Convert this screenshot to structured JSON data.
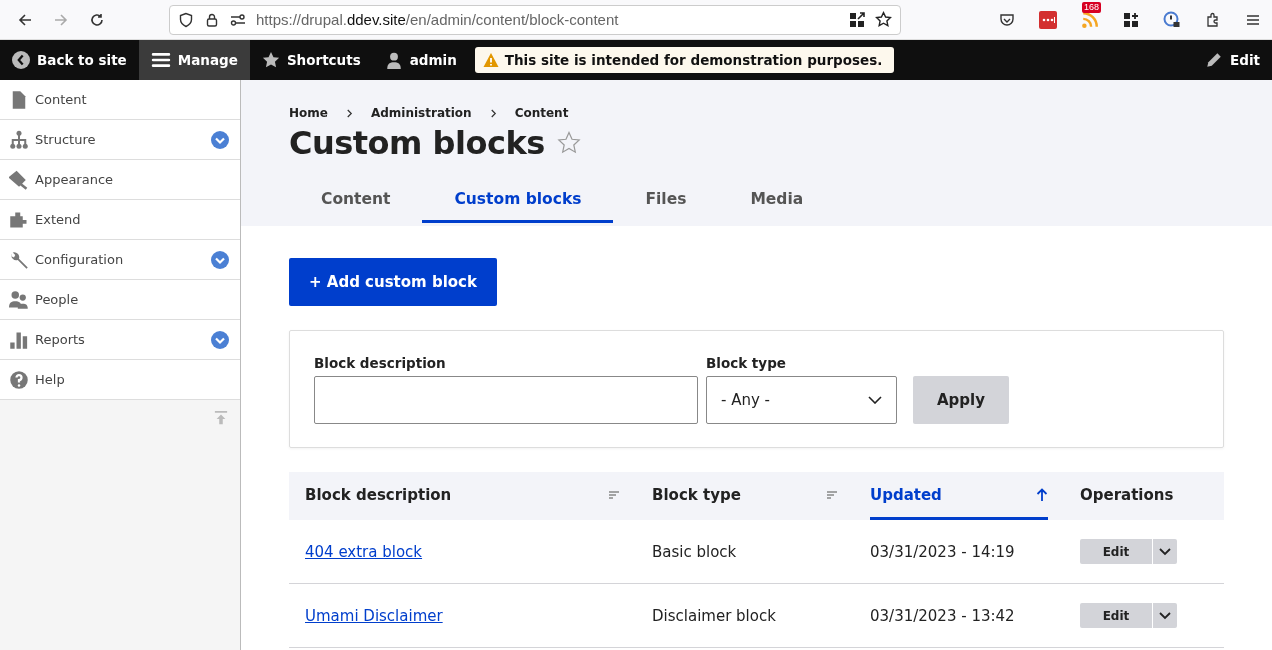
{
  "browser": {
    "url": {
      "scheme": "https://drupal.",
      "host": "ddev.site",
      "path": "/en/admin/content/block-content"
    },
    "feed_badge": "168"
  },
  "toolbar": {
    "items": [
      {
        "kind": "back",
        "label": "Back to site",
        "selected": false
      },
      {
        "kind": "manage",
        "label": "Manage",
        "selected": true
      },
      {
        "kind": "shortcuts",
        "label": "Shortcuts",
        "selected": false
      },
      {
        "kind": "user",
        "label": "admin",
        "selected": false
      }
    ],
    "notice": "This site is intended for demonstration purposes.",
    "edit": "Edit"
  },
  "sidebar": {
    "items": [
      {
        "kind": "content",
        "label": "Content",
        "expandable": false
      },
      {
        "kind": "structure",
        "label": "Structure",
        "expandable": true
      },
      {
        "kind": "appearance",
        "label": "Appearance",
        "expandable": false
      },
      {
        "kind": "extend",
        "label": "Extend",
        "expandable": false
      },
      {
        "kind": "configuration",
        "label": "Configuration",
        "expandable": true
      },
      {
        "kind": "people",
        "label": "People",
        "expandable": false
      },
      {
        "kind": "reports",
        "label": "Reports",
        "expandable": true
      },
      {
        "kind": "help",
        "label": "Help",
        "expandable": false
      }
    ]
  },
  "breadcrumb": [
    "Home",
    "Administration",
    "Content"
  ],
  "title": "Custom blocks",
  "tabs": [
    {
      "label": "Content",
      "selected": false
    },
    {
      "label": "Custom blocks",
      "selected": true
    },
    {
      "label": "Files",
      "selected": false
    },
    {
      "label": "Media",
      "selected": false
    }
  ],
  "add_button": "+ Add custom block",
  "filter": {
    "description_label": "Block description",
    "type_label": "Block type",
    "type_value": "- Any -",
    "apply": "Apply"
  },
  "table": {
    "columns": [
      {
        "label": "Block description",
        "sortable": true,
        "selected": false
      },
      {
        "label": "Block type",
        "sortable": true,
        "selected": false
      },
      {
        "label": "Updated",
        "sortable": true,
        "selected": true
      },
      {
        "label": "Operations",
        "sortable": false,
        "selected": false
      }
    ],
    "rows": [
      {
        "description": "404 extra block",
        "type": "Basic block",
        "updated": "03/31/2023 - 14:19",
        "operation": "Edit"
      },
      {
        "description": "Umami Disclaimer",
        "type": "Disclaimer block",
        "updated": "03/31/2023 - 13:42",
        "operation": "Edit"
      }
    ]
  }
}
